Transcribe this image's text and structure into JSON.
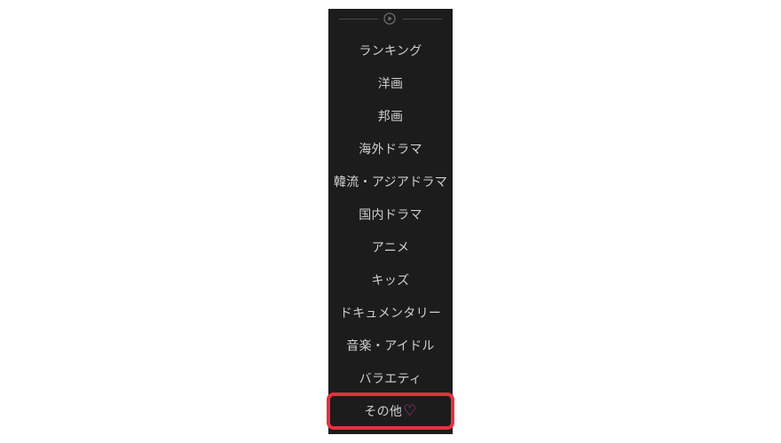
{
  "menu": {
    "items": [
      {
        "label": "ランキング"
      },
      {
        "label": "洋画"
      },
      {
        "label": "邦画"
      },
      {
        "label": "海外ドラマ"
      },
      {
        "label": "韓流・アジアドラマ"
      },
      {
        "label": "国内ドラマ"
      },
      {
        "label": "アニメ"
      },
      {
        "label": "キッズ"
      },
      {
        "label": "ドキュメンタリー"
      },
      {
        "label": "音楽・アイドル"
      },
      {
        "label": "バラエティ"
      },
      {
        "label": "その他",
        "heart": "♡"
      }
    ]
  },
  "icons": {
    "header": "play-circle-icon",
    "favorite": "heart-outline-icon"
  },
  "colors": {
    "panel_background": "#1c1c1c",
    "item_text": "#cfcfcf",
    "highlight": "#e8303f",
    "heart": "#e0409a"
  }
}
